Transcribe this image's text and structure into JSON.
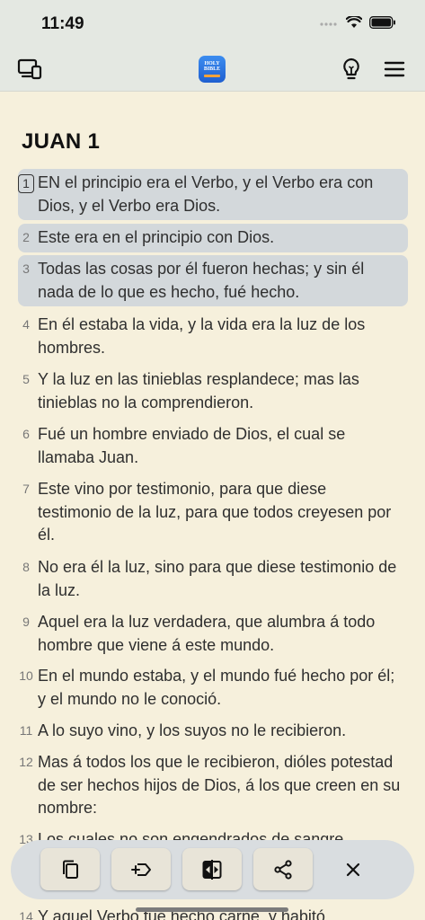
{
  "status": {
    "time": "11:49"
  },
  "appbar": {
    "left_icon": "devices-icon",
    "logo_text_1": "HOLY",
    "logo_text_2": "BIBLE",
    "right_icons": [
      "lightbulb-icon",
      "menu-icon"
    ]
  },
  "chapter": {
    "title": "JUAN 1"
  },
  "verses": [
    {
      "num": "1",
      "text": "EN el principio era el Verbo, y el Verbo era con Dios, y el Verbo era Dios.",
      "selected": true
    },
    {
      "num": "2",
      "text": "Este era en el principio con Dios.",
      "selected": true
    },
    {
      "num": "3",
      "text": "Todas las cosas por él fueron hechas; y sin él nada de lo que es hecho, fué hecho.",
      "selected": true
    },
    {
      "num": "4",
      "text": "En él estaba la vida, y la vida era la luz de los hombres."
    },
    {
      "num": "5",
      "text": "Y la luz en las tinieblas resplandece; mas las tinieblas no la comprendieron."
    },
    {
      "num": "6",
      "text": "Fué un hombre enviado de Dios, el cual se llamaba Juan."
    },
    {
      "num": "7",
      "text": "Este vino por testimonio, para que diese testimonio de la luz, para que todos creyesen por él."
    },
    {
      "num": "8",
      "text": "No era él la luz, sino para que diese testimonio de la luz."
    },
    {
      "num": "9",
      "text": "Aquel era la luz verdadera, que alumbra á todo hombre que viene á este mundo."
    },
    {
      "num": "10",
      "text": "En el mundo estaba, y el mundo fué hecho por él; y el mundo no le conoció."
    },
    {
      "num": "11",
      "text": "A lo suyo vino, y los suyos no le recibieron."
    },
    {
      "num": "12",
      "text": "Mas á todos los que le recibieron, dióles potestad de ser hechos hijos de Dios, á los que creen en su nombre:"
    },
    {
      "num": "13",
      "text": "Los cuales no son engendrados de sangre,"
    },
    {
      "num": "14",
      "text": "Y aquel Verbo fué hecho carne, y habitó"
    }
  ],
  "toolbar": {
    "buttons": [
      "copy-icon",
      "add-note-icon",
      "compare-icon",
      "share-icon"
    ],
    "close": "close-icon"
  },
  "colors": {
    "background": "#f6f0dc",
    "selection": "#d3d8db",
    "bar": "#e4e8e2"
  }
}
